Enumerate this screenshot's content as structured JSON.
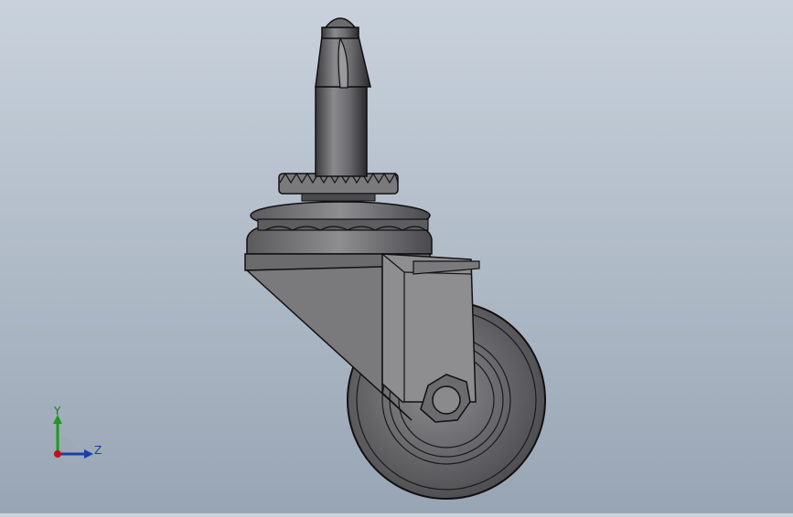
{
  "viewport": {
    "model": "caster-wheel-assembly",
    "view": "front"
  },
  "triad": {
    "y_label": "Y",
    "z_label": "Z",
    "colors": {
      "x": "#c0121a",
      "y": "#1d9b1d",
      "z": "#1a3ea8"
    }
  },
  "colors": {
    "background_top": "#c9d2dc",
    "background_bottom": "#98a5b4",
    "part_dark": "#3a3a3c",
    "part_mid": "#6b6b6e",
    "part_light": "#9a9a9d",
    "edge": "#101012"
  }
}
